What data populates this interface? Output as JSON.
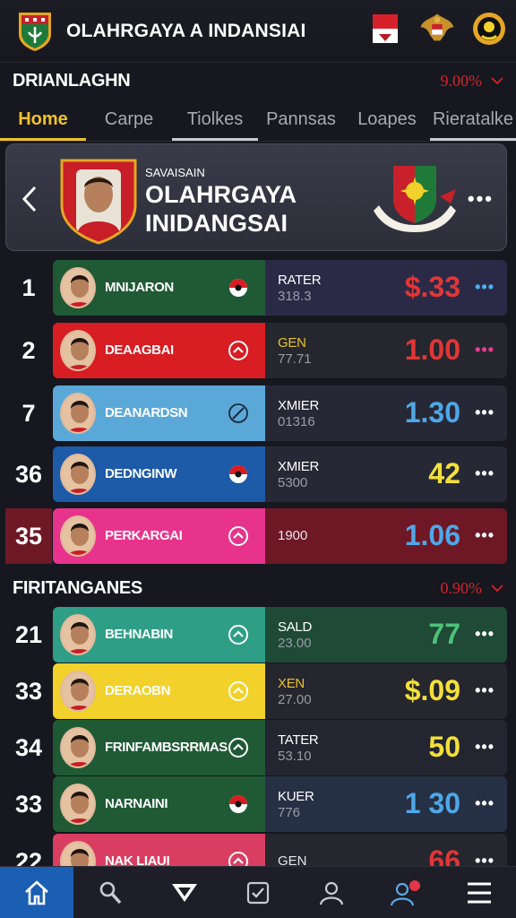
{
  "app": {
    "title": "OLAHRGAYA A INDANSIAI"
  },
  "section1": {
    "title": "DRIANLAGHN",
    "pct": "9.00%"
  },
  "tabs": [
    "Home",
    "Carpe",
    "Tiolkes",
    "Pannsas",
    "Loapes",
    "Rieratalke"
  ],
  "hero": {
    "small": "SAVAISAIN",
    "line1": "OLAHRGAYA",
    "line2": "INIDANGSAI"
  },
  "section2": {
    "title": "FIRITANGANES",
    "pct": "0.90%"
  },
  "rows": [
    {
      "rank": "1",
      "name": "MNIJARON",
      "label": "RATER",
      "sub": "318.3",
      "value": "$.33",
      "card": "#1f5a35",
      "stat": "#2b2a46",
      "valcolor": "#e23636",
      "dotcolor": "#4ab0f0",
      "rankbg": "#16171f"
    },
    {
      "rank": "2",
      "name": "DEAAGBAI",
      "label": "GEN",
      "sub": "77.71",
      "value": "1.00",
      "card": "#d81d23",
      "stat": "#26262e",
      "valcolor": "#e23636",
      "dotcolor": "#e2408c",
      "rankbg": "#16171f",
      "labelcolor": "#e8c230"
    },
    {
      "rank": "7",
      "name": "DEANARDSN",
      "label": "XMIER",
      "sub": "01316",
      "value": "1.30",
      "card": "#5aa8d8",
      "stat": "#272836",
      "valcolor": "#4ea8e8",
      "dotcolor": "#ffffff",
      "rankbg": "#16171f"
    },
    {
      "rank": "36",
      "name": "DEDNGINW",
      "label": "XMIER",
      "sub": "5300",
      "value": "42",
      "card": "#1d5aa8",
      "stat": "#272836",
      "valcolor": "#f2e03a",
      "dotcolor": "#ffffff",
      "rankbg": "#16171f"
    },
    {
      "rank": "35",
      "name": "PERKARGAI",
      "label": "",
      "sub": "1900",
      "value": "1.06",
      "card": "#e8338c",
      "stat": "#6e1826",
      "valcolor": "#4ea8e8",
      "dotcolor": "#ffffff",
      "rankbg": "#6e1826"
    },
    {
      "rank": "21",
      "name": "BEHNABIN",
      "label": "SALD",
      "sub": "23.00",
      "value": "77",
      "card": "#2e9e86",
      "stat": "#1e4a36",
      "valcolor": "#4ec27a",
      "dotcolor": "#ffffff",
      "rankbg": "#16171f"
    },
    {
      "rank": "33",
      "name": "DERAOBN",
      "label": "XEN",
      "sub": "27.00",
      "value": "$.09",
      "card": "#f2d22a",
      "stat": "#26262e",
      "valcolor": "#f2e03a",
      "dotcolor": "#ffffff",
      "rankbg": "#16171f",
      "labelcolor": "#e8c230"
    },
    {
      "rank": "34",
      "name": "FRINFAMBSRRMAS",
      "label": "TATER",
      "sub": "53.10",
      "value": "50",
      "card": "#1f5a35",
      "stat": "#232630",
      "valcolor": "#f2e03a",
      "dotcolor": "#ffffff",
      "rankbg": "#16171f"
    },
    {
      "rank": "33",
      "name": "NARNAINI",
      "label": "KUER",
      "sub": "776",
      "value": "1 30",
      "card": "#1f5a35",
      "stat": "#263044",
      "valcolor": "#4ea8e8",
      "dotcolor": "#ffffff",
      "rankbg": "#16171f"
    },
    {
      "rank": "22",
      "name": "NAK LIAUI",
      "label": "",
      "sub": "GEN",
      "value": "66",
      "card": "#d93e62",
      "stat": "#26262e",
      "valcolor": "#e23636",
      "dotcolor": "#ffffff",
      "rankbg": "#16171f"
    }
  ],
  "colors": {
    "accent": "#f0c22a",
    "danger": "#d8232a",
    "nav_active": "#1b5fb4"
  },
  "nav": [
    "home-icon",
    "search-icon",
    "stats-icon",
    "check-icon",
    "profile-icon",
    "users-icon",
    "menu-icon"
  ]
}
